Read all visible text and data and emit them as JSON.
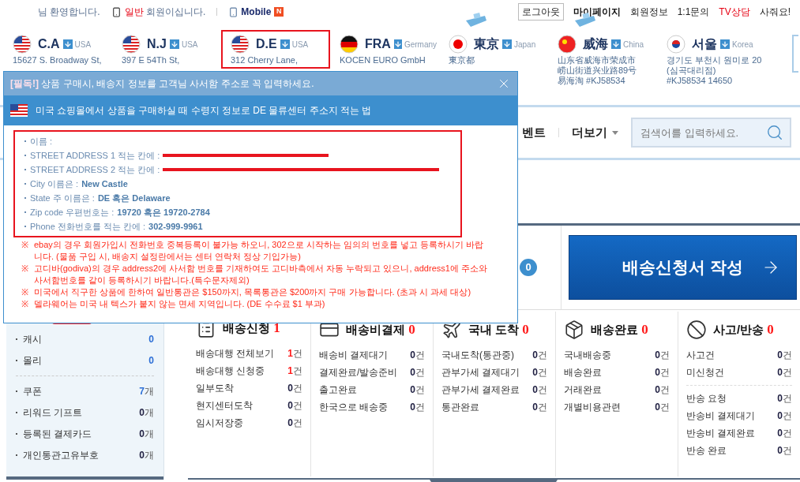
{
  "top_bar": {
    "welcome": "님 환영합니다.",
    "grade": "일반",
    "grade_suffix": "회원이십니다.",
    "mobile": "Mobile",
    "mobile_badge": "N",
    "links": [
      {
        "label": "로그아웃",
        "kind": "button"
      },
      {
        "label": "마이페이지",
        "kind": "bold"
      },
      {
        "label": "회원정보",
        "kind": "plain"
      },
      {
        "label": "1:1문의",
        "kind": "plain"
      },
      {
        "label": "TV상담",
        "kind": "red"
      },
      {
        "label": "사줘요!",
        "kind": "plain"
      }
    ]
  },
  "centers": [
    {
      "name": "C.A",
      "country": "USA",
      "kind": "us",
      "selected": false,
      "ship": false,
      "address": [
        "15627 S. Broadway St,"
      ]
    },
    {
      "name": "N.J",
      "country": "USA",
      "kind": "us",
      "selected": false,
      "ship": false,
      "address": [
        "397 E 54Th St,"
      ]
    },
    {
      "name": "D.E",
      "country": "USA",
      "kind": "us",
      "selected": true,
      "ship": false,
      "address": [
        "312 Cherry Lane,"
      ]
    },
    {
      "name": "FRA",
      "country": "Germany",
      "kind": "de",
      "selected": false,
      "ship": false,
      "address": [
        "KOCEN EURO GmbH"
      ]
    },
    {
      "name": "東京",
      "country": "Japan",
      "kind": "jp",
      "selected": false,
      "ship": true,
      "address": [
        "東京都"
      ]
    },
    {
      "name": "威海",
      "country": "China",
      "kind": "cn",
      "selected": false,
      "ship": true,
      "address": [
        "山东省威海市荣成市",
        "崂山街道兴业路89号",
        "易海淘 #KJ58534"
      ]
    },
    {
      "name": "서울",
      "country": "Korea",
      "kind": "kr",
      "selected": false,
      "ship": false,
      "address": [
        "경기도 부천시 원미로 20",
        "(심곡대리점)",
        "#KJ58534 14650"
      ]
    }
  ],
  "nav": {
    "items": [
      "벤트"
    ],
    "more": "더보기",
    "search": {
      "placeholder": "검색어를 입력하세요."
    }
  },
  "apply_button": "배송신청서 작성",
  "apply_badge": "0",
  "sidebar": {
    "groups": [
      [
        {
          "label": "캐시",
          "count": "0",
          "highlight": true
        },
        {
          "label": "몰리",
          "count": "0",
          "highlight": true
        }
      ],
      [
        {
          "label": "쿠폰",
          "count": "7",
          "unit": "개",
          "highlight": true
        },
        {
          "label": "리워드 기프트",
          "count": "0",
          "unit": "개",
          "highlight": false
        },
        {
          "label": "등록된 결제카드",
          "count": "0",
          "unit": "개",
          "highlight": false
        },
        {
          "label": "개인통관고유부호",
          "count": "0",
          "unit": "개",
          "highlight": false
        }
      ]
    ]
  },
  "dashboard": [
    {
      "title": "배송신청",
      "count": "1",
      "kind": "list",
      "groups": [
        [
          {
            "label": "배송대행 전체보기",
            "count": "1",
            "unit": "건",
            "highlight": true
          },
          {
            "label": "배송대행 신청중",
            "count": "1",
            "unit": "건",
            "highlight": true
          },
          {
            "label": "일부도착",
            "count": "0",
            "unit": "건",
            "highlight": false
          },
          {
            "label": "현지센터도착",
            "count": "0",
            "unit": "건",
            "highlight": false
          },
          {
            "label": "임시저장중",
            "count": "0",
            "unit": "건",
            "highlight": false
          }
        ]
      ]
    },
    {
      "title": "배송비결제",
      "count": "0",
      "kind": "card",
      "groups": [
        [
          {
            "label": "배송비 결제대기",
            "count": "0",
            "unit": "건",
            "highlight": false
          },
          {
            "label": "결제완료/발송준비",
            "count": "0",
            "unit": "건",
            "highlight": false
          },
          {
            "label": "출고완료",
            "count": "0",
            "unit": "건",
            "highlight": false
          },
          {
            "label": "한국으로 배송중",
            "count": "0",
            "unit": "건",
            "highlight": false
          }
        ]
      ]
    },
    {
      "title": "국내 도착",
      "count": "0",
      "kind": "plane",
      "groups": [
        [
          {
            "label": "국내도착(통관중)",
            "count": "0",
            "unit": "건",
            "highlight": false
          },
          {
            "label": "관부가세 결제대기",
            "count": "0",
            "unit": "건",
            "highlight": false
          },
          {
            "label": "관부가세 결제완료",
            "count": "0",
            "unit": "건",
            "highlight": false
          },
          {
            "label": "통관완료",
            "count": "0",
            "unit": "건",
            "highlight": false
          }
        ]
      ]
    },
    {
      "title": "배송완료",
      "count": "0",
      "kind": "box",
      "groups": [
        [
          {
            "label": "국내배송중",
            "count": "0",
            "unit": "건",
            "highlight": false
          },
          {
            "label": "배송완료",
            "count": "0",
            "unit": "건",
            "highlight": false
          },
          {
            "label": "거래완료",
            "count": "0",
            "unit": "건",
            "highlight": false
          },
          {
            "label": "개별비용관련",
            "count": "0",
            "unit": "건",
            "highlight": false
          }
        ]
      ]
    },
    {
      "title": "사고/반송",
      "count": "0",
      "kind": "ban",
      "groups": [
        [
          {
            "label": "사고건",
            "count": "0",
            "unit": "건",
            "highlight": false
          },
          {
            "label": "미신청건",
            "count": "0",
            "unit": "건",
            "highlight": false
          }
        ],
        [
          {
            "label": "반송 요청",
            "count": "0",
            "unit": "건",
            "highlight": false
          },
          {
            "label": "반송비 결제대기",
            "count": "0",
            "unit": "건",
            "highlight": false
          },
          {
            "label": "반송비 결제완료",
            "count": "0",
            "unit": "건",
            "highlight": false
          },
          {
            "label": "반송 완료",
            "count": "0",
            "unit": "건",
            "highlight": false
          }
        ]
      ]
    }
  ],
  "popup": {
    "tag": "[필독!]",
    "title": "상품 구매시, 배송지 정보를 고객님 사서함 주소로 꼭 입력하세요.",
    "subtitle": "미국 쇼핑몰에서 상품을 구매하실 때 수령지 정보로 DE 물류센터 주소지 적는 법",
    "fields": [
      {
        "label": "이름 :",
        "redacted": false
      },
      {
        "label": "STREET ADDRESS 1 적는 칸에 :",
        "redacted": true
      },
      {
        "label": "STREET ADDRESS 2 적는 칸에 :",
        "redacted": true
      },
      {
        "label": "City 이름은 :",
        "value": "New Castle",
        "redacted": false
      },
      {
        "label": "State 주 이름은 :",
        "value": "DE 혹은 Delaware",
        "redacted": false
      },
      {
        "label": "Zip code 우편번호는 :",
        "value": "19720 혹은 19720-2784",
        "redacted": false
      },
      {
        "label": "Phone 전화번호를 적는 칸에 :",
        "value": "302-999-9961",
        "redacted": false
      }
    ],
    "notes": [
      {
        "mark": "※",
        "text": "ebay의 경우 회원가입시 전화번호 중복등록이 불가능 하오니, 302으로 시작하는 임의의 번호를 넣고 등록하시기 바랍니다. (물품 구입 시, 배송지 설정란에서는 센터 연락처 정상 기입가능)"
      },
      {
        "mark": "※",
        "text": "고디바(godiva)의 경우 address2에 사서함 번호를 기재하여도 고디바측에서 자동 누락되고 있으니, address1에 주소와 사서함번호를 같이 등록하시기 바랍니다.(특수문자제외)"
      },
      {
        "mark": "※",
        "text": "미국에서 직구한 상품에 한하여 일반통관은 $150까지, 목록통관은 $200까지 구매 가능합니다. (초과 시 과세 대상)"
      },
      {
        "mark": "※",
        "text": "델라웨어는 미국 내 텍스가 붙지 않는 면세 지역입니다. (DE 수수료 $1 부과)"
      }
    ]
  }
}
